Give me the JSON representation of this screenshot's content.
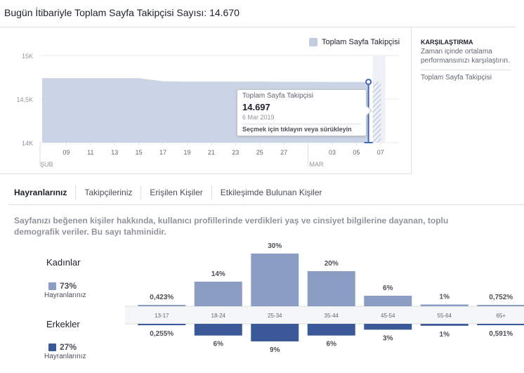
{
  "header": {
    "title": "Bugün İtibariyle Toplam Sayfa Takipçisi Sayısı: 14.670"
  },
  "colors": {
    "area_fill": "#c2cce0",
    "women_bar": "#8b9dc3",
    "men_bar": "#3b5998",
    "accent": "#4267b2"
  },
  "follower_chart": {
    "legend_label": "Toplam Sayfa Takipçisi",
    "y_ticks": [
      "15K",
      "14,5K",
      "14K"
    ],
    "x_ticks": [
      "09",
      "11",
      "13",
      "15",
      "17",
      "19",
      "21",
      "23",
      "25",
      "27",
      "03",
      "05",
      "07"
    ],
    "month_labels": [
      "ŞUB",
      "MAR"
    ],
    "tooltip": {
      "series": "Toplam Sayfa Takipçisi",
      "value": "14.697",
      "date": "6 Mar 2019",
      "hint": "Seçmek için tıklayın veya sürükleyin"
    }
  },
  "chart_data": [
    {
      "type": "area",
      "legend": [
        "Toplam Sayfa Takipçisi"
      ],
      "x_ticks": [
        "09",
        "11",
        "13",
        "15",
        "17",
        "19",
        "21",
        "23",
        "25",
        "27",
        "03",
        "05",
        "07"
      ],
      "ylim": [
        14000,
        15000
      ],
      "y_ticks": [
        "15K",
        "14,5K",
        "14K"
      ],
      "series": [
        {
          "name": "Toplam Sayfa Takipçisi",
          "x": [
            "07 Şub",
            "09 Şub",
            "11 Şub",
            "13 Şub",
            "15 Şub",
            "17 Şub",
            "19 Şub",
            "21 Şub",
            "23 Şub",
            "25 Şub",
            "27 Şub",
            "01 Mar",
            "03 Mar",
            "05 Mar",
            "06 Mar"
          ],
          "values": [
            14740,
            14740,
            14740,
            14740,
            14740,
            14705,
            14700,
            14700,
            14700,
            14700,
            14698,
            14698,
            14697,
            14697,
            14697
          ]
        }
      ]
    },
    {
      "type": "bar",
      "categories": [
        "13-17",
        "18-24",
        "25-34",
        "35-44",
        "45-54",
        "55-64",
        "65+"
      ],
      "series": [
        {
          "name": "Kadınlar",
          "values": [
            0.423,
            14,
            30,
            20,
            6,
            1,
            0.752
          ],
          "labels": [
            "0,423%",
            "14%",
            "30%",
            "20%",
            "6%",
            "1%",
            "0,752%"
          ]
        },
        {
          "name": "Erkekler",
          "values": [
            0.255,
            6,
            9,
            6,
            3,
            1,
            0.591
          ],
          "labels": [
            "0,255%",
            "6%",
            "9%",
            "6%",
            "3%",
            "1%",
            "0,591%"
          ]
        }
      ]
    }
  ],
  "side_panel": {
    "title": "KARŞILAŞTIRMA",
    "description": "Zaman içinde ortalama performansınızı karşılaştırın.",
    "series_label": "Toplam Sayfa Takipçisi"
  },
  "tabs": [
    {
      "label": "Hayranlarınız"
    },
    {
      "label": "Takipçileriniz"
    },
    {
      "label": "Erişilen Kişiler"
    },
    {
      "label": "Etkileşimde Bulunan Kişiler"
    }
  ],
  "demographics": {
    "description": "Sayfanızı beğenen kişiler hakkında, kullanıcı profillerinde verdikleri yaş ve cinsiyet bilgilerine dayanan, toplu demografik veriler. Bu sayı tahminidir.",
    "women": {
      "label": "Kadınlar",
      "percent": "73%",
      "sublabel": "Hayranlarınız"
    },
    "men": {
      "label": "Erkekler",
      "percent": "27%",
      "sublabel": "Hayranlarınız"
    }
  }
}
